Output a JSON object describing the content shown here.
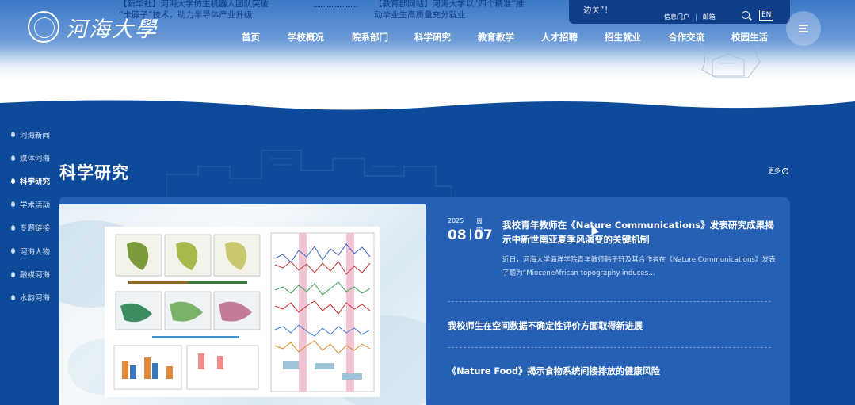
{
  "header": {
    "logo_text": "河海大學",
    "ticker": [
      {
        "line1": "【新华社】河海大学仿生机器人团队突破",
        "line2": "“卡脖子”技术，助力半导体产业升级"
      },
      {
        "line1": "【教育部网站】河海大学以“四个精准”推",
        "line2": "动毕业生高质量充分就业"
      }
    ],
    "utility": {
      "promo": "边关”！",
      "portal": "信息门户",
      "email": "邮箱",
      "lang": "EN"
    },
    "nav": [
      "首页",
      "学校概况",
      "院系部门",
      "科学研究",
      "教育教学",
      "人才招聘",
      "招生就业",
      "合作交流",
      "校园生活"
    ]
  },
  "sidebar": {
    "items": [
      {
        "label": "河海新闻",
        "active": false
      },
      {
        "label": "媒体河海",
        "active": false
      },
      {
        "label": "科学研究",
        "active": true
      },
      {
        "label": "学术活动",
        "active": false
      },
      {
        "label": "专题链接",
        "active": false
      },
      {
        "label": "河海人物",
        "active": false
      },
      {
        "label": "融媒河海",
        "active": false
      },
      {
        "label": "水韵河海",
        "active": false
      }
    ]
  },
  "section": {
    "title": "科学研究",
    "more": "更多"
  },
  "featured": {
    "year": "2025",
    "weekday": "周四",
    "month": "08",
    "day": "07",
    "title": "我校青年教师在《Nature Communications》发表研究成果揭示中新世南亚夏季风演变的关键机制",
    "summary": "近日，河海大学海洋学院青年教师韩子轩及其合作者在《Nature Communications》发表了题为“MioceneAfrican topography induces…"
  },
  "news_list": [
    {
      "title": "我校师生在空间数据不确定性评价方面取得新进展"
    },
    {
      "title": "《Nature Food》揭示食物系统间接排放的健康风险"
    }
  ],
  "colors": {
    "brand_blue": "#0d4a9a",
    "card_blue": "#2560b4",
    "utility_bar": "#103f8a"
  }
}
